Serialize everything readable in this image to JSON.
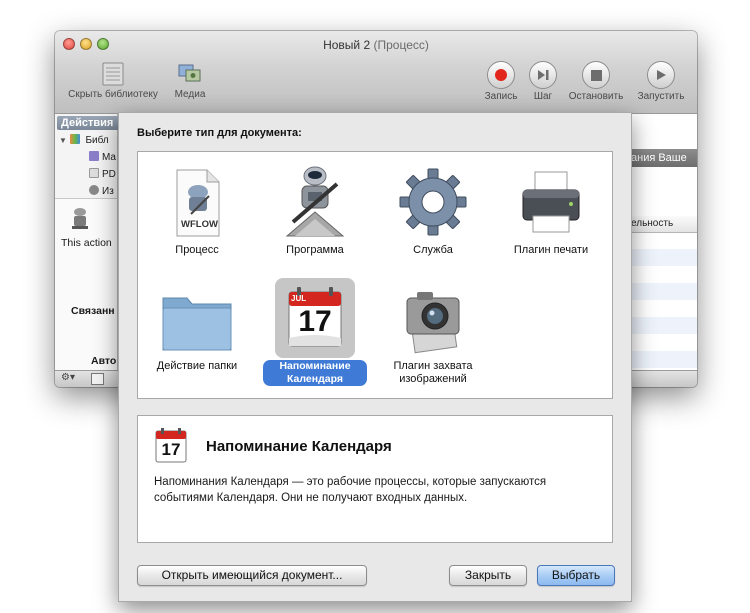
{
  "window": {
    "title": "Новый 2",
    "title_sub": "(Процесс)"
  },
  "toolbar": {
    "hide_library": "Скрыть библиотеку",
    "media": "Медиа",
    "record": "Запись",
    "step": "Шаг",
    "stop": "Остановить",
    "run": "Запустить"
  },
  "library": {
    "tab": "Действия",
    "rows": [
      "Библ",
      "Ma",
      "PD",
      "Из"
    ],
    "action_text": "This action",
    "related": "Связанн",
    "author": "Авто"
  },
  "right_panel": {
    "header": "ания Ваше",
    "column": "ельность"
  },
  "sheet": {
    "prompt": "Выберите тип для документа:",
    "types": [
      {
        "label": "Процесс",
        "icon": "wflow-document-icon",
        "badge": "WFLOW"
      },
      {
        "label": "Программа",
        "icon": "automator-robot-icon"
      },
      {
        "label": "Служба",
        "icon": "gear-icon"
      },
      {
        "label": "Плагин печати",
        "icon": "printer-icon"
      },
      {
        "label": "Действие папки",
        "icon": "folder-icon"
      },
      {
        "label": "Напоминание Календаря",
        "icon": "calendar-icon"
      },
      {
        "label": "Плагин захвата изображений",
        "icon": "camera-icon"
      }
    ],
    "calendar": {
      "month": "JUL",
      "day": "17"
    },
    "selected_index": 5,
    "description": {
      "title": "Напоминание Календаря",
      "text": "Напоминания Календаря — это рабочие процессы, которые запускаются событиями Календаря. Они не получают входных данных."
    },
    "buttons": {
      "open_existing": "Открыть имеющийся документ...",
      "close": "Закрыть",
      "choose": "Выбрать"
    }
  },
  "colors": {
    "selection": "#3f7bd6",
    "default_button": "#a9cdf5"
  }
}
